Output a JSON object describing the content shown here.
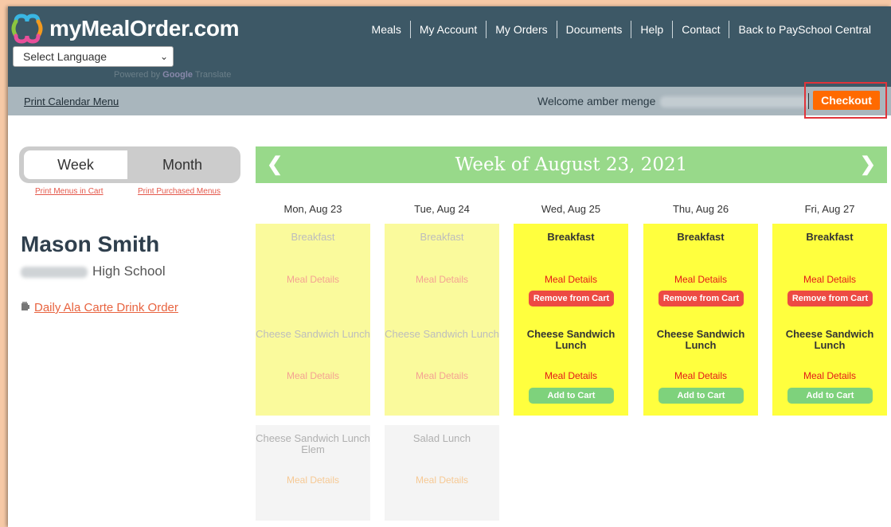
{
  "header": {
    "logo_text": "myMealOrder.com",
    "language_select": "Select Language",
    "powered_by": "Powered by",
    "google": "Google",
    "translate": "Translate",
    "nav": [
      "Meals",
      "My Account",
      "My Orders",
      "Documents",
      "Help",
      "Contact",
      "Back to PaySchool Central"
    ]
  },
  "subbar": {
    "print_calendar": "Print Calendar Menu",
    "welcome": "Welcome amber menge",
    "checkout": "Checkout"
  },
  "sidebar": {
    "toggle": [
      "Week",
      "Month"
    ],
    "print_cart": "Print Menus in Cart",
    "print_purchased": "Print Purchased Menus",
    "student_name": "Mason Smith",
    "school": "High School",
    "drink_link": "Daily Ala Carte Drink Order"
  },
  "calendar": {
    "title": "Week of August 23, 2021",
    "days": [
      "Mon, Aug 23",
      "Tue, Aug 24",
      "Wed, Aug 25",
      "Thu, Aug 26",
      "Fri, Aug 27"
    ],
    "meal_details": "Meal Details",
    "remove_label": "Remove from Cart",
    "add_label": "Add to Cart",
    "breakfast": "Breakfast",
    "cheese_lunch": "Cheese Sandwich Lunch",
    "cheese_lunch_elem": "Cheese Sandwich Lunch Elem",
    "salad_lunch": "Salad Lunch"
  },
  "colors": {
    "header": "#3d5866",
    "subbar": "#a9b6bd",
    "checkout": "#ff6a00",
    "week_bar": "#98d98a",
    "cell_bright": "#ffff3e",
    "cell_light": "#fafa9c"
  }
}
